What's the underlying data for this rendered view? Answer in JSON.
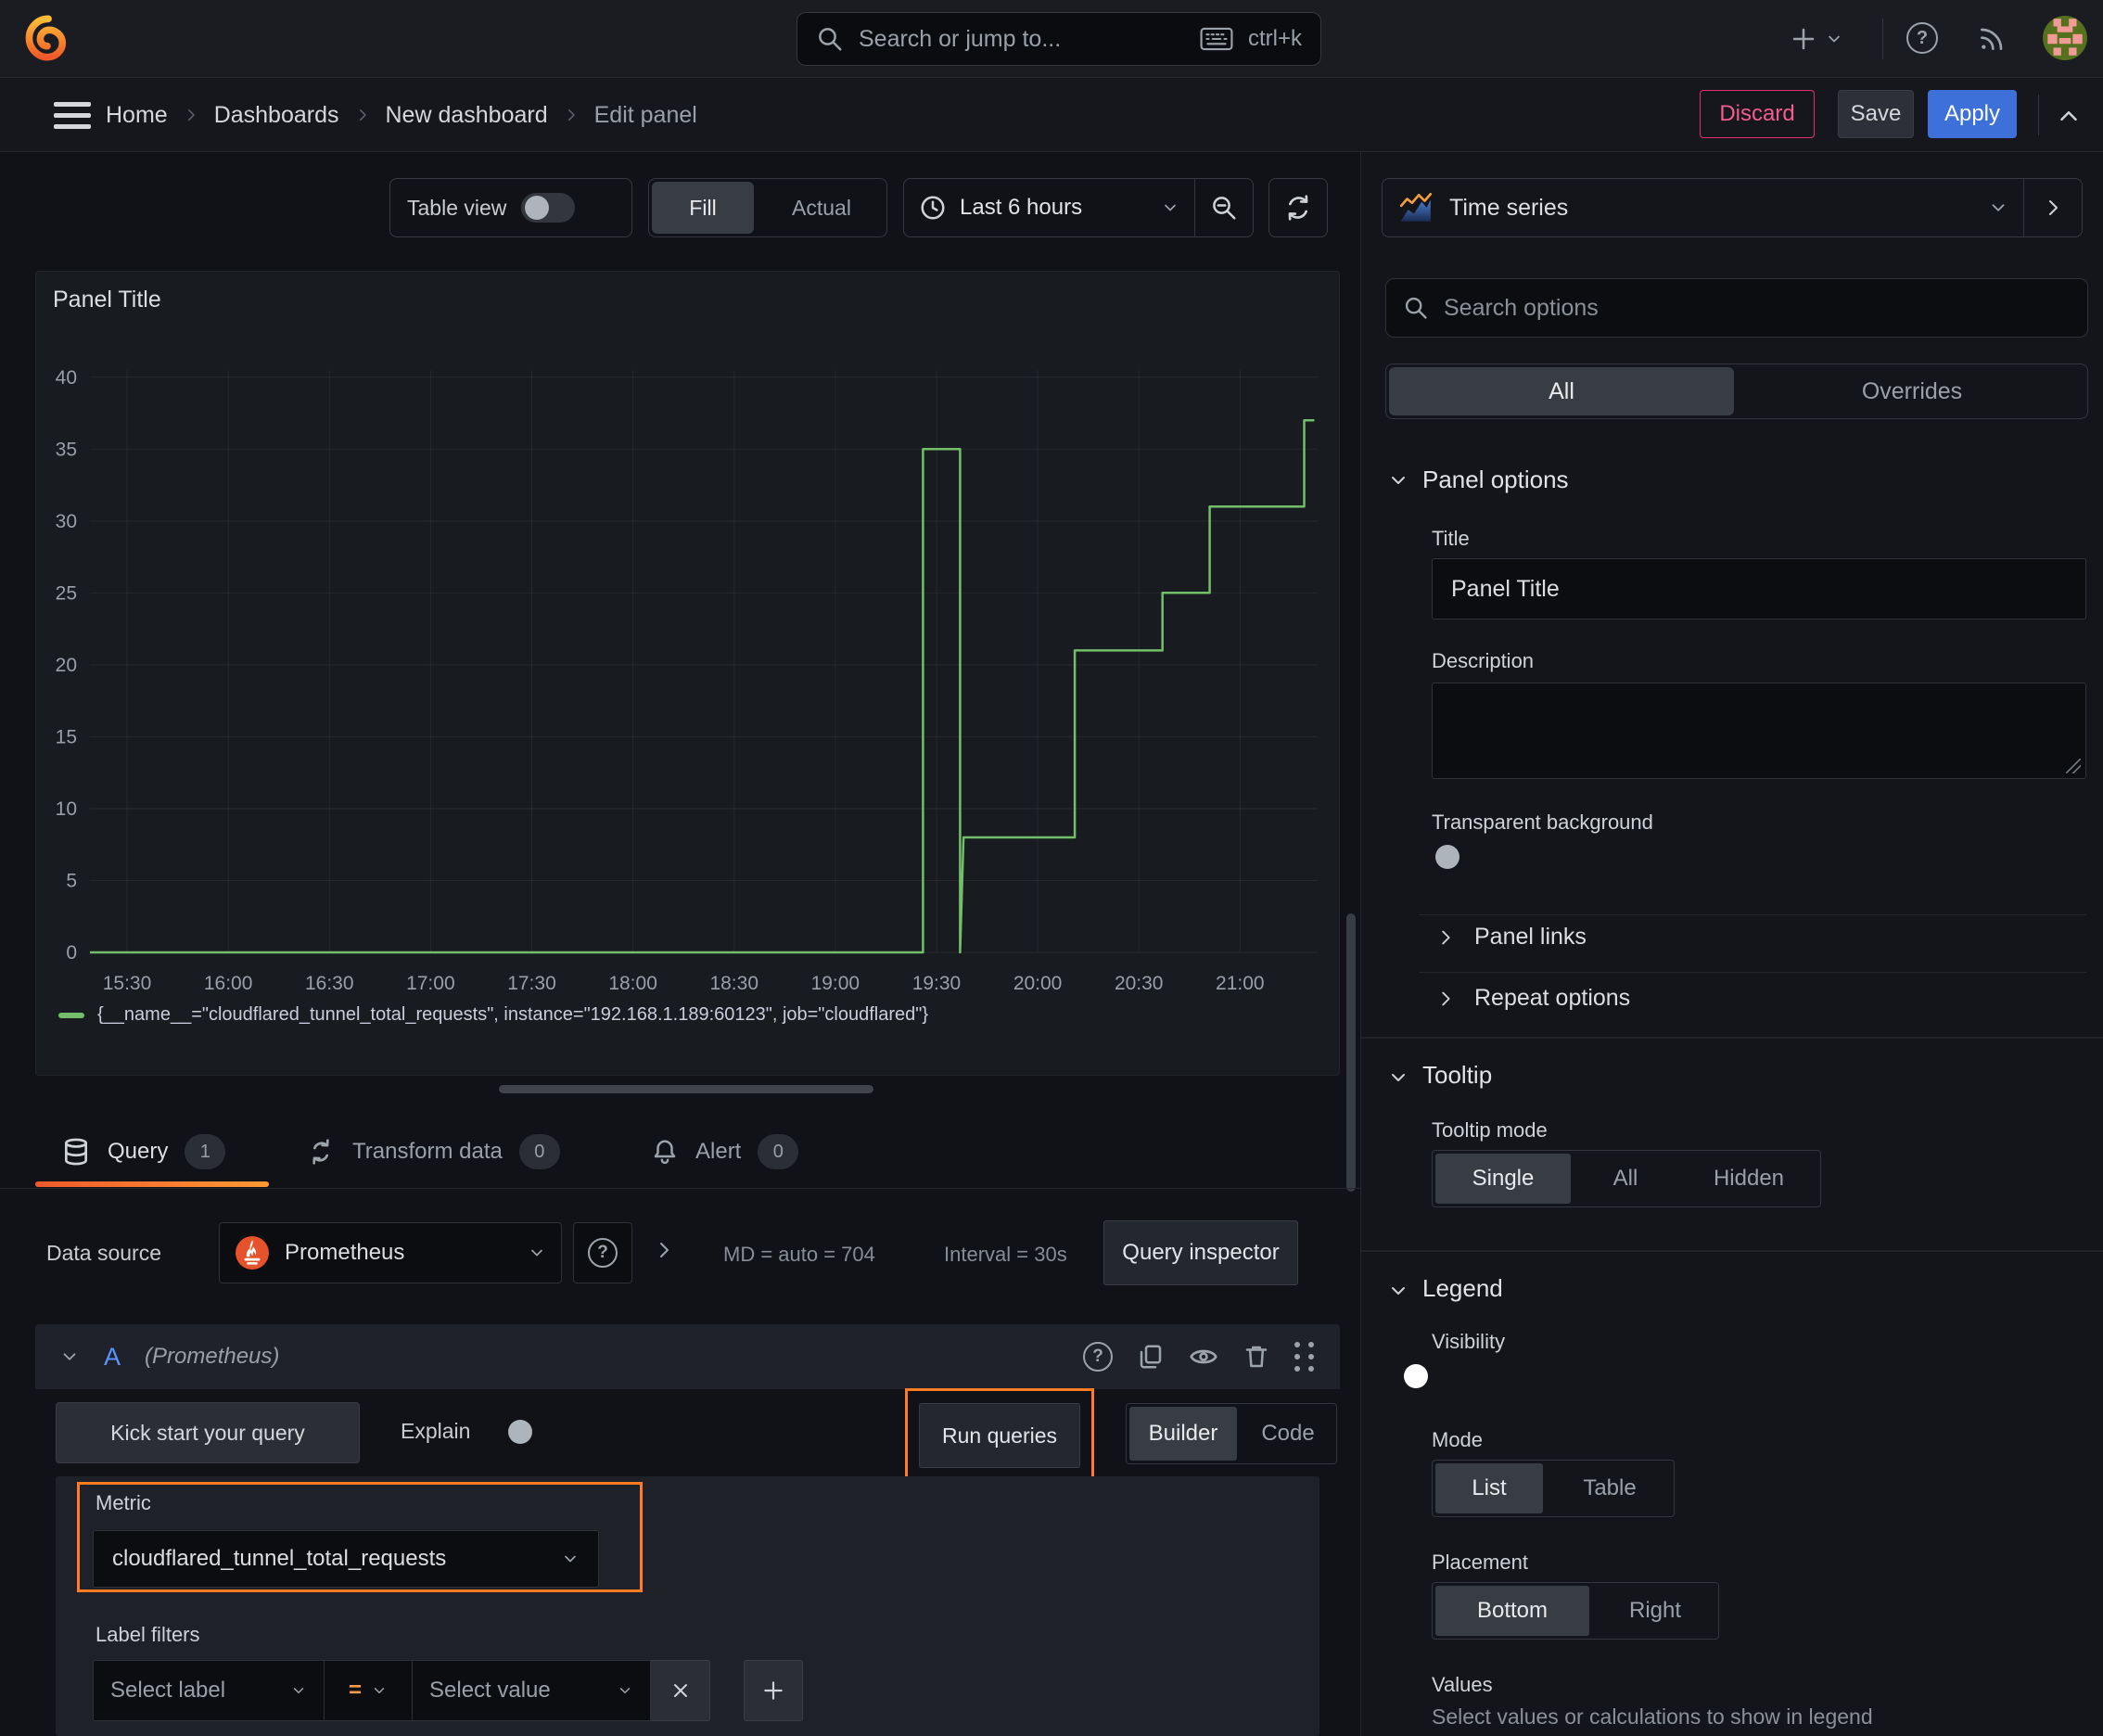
{
  "topbar": {
    "search_placeholder": "Search or jump to...",
    "search_shortcut": "ctrl+k"
  },
  "breadcrumb": {
    "items": [
      "Home",
      "Dashboards",
      "New dashboard",
      "Edit panel"
    ]
  },
  "actions": {
    "discard": "Discard",
    "save": "Save",
    "apply": "Apply"
  },
  "panel_toolbar": {
    "table_view_label": "Table view",
    "fill": "Fill",
    "actual": "Actual",
    "time_range": "Last 6 hours"
  },
  "viz_picker": {
    "label": "Time series"
  },
  "panel": {
    "title": "Panel Title"
  },
  "chart_data": {
    "type": "line",
    "title": "Panel Title",
    "x_start": "15:19",
    "x_end": "21:23",
    "x_ticks": [
      "15:30",
      "16:00",
      "16:30",
      "17:00",
      "17:30",
      "18:00",
      "18:30",
      "19:00",
      "19:30",
      "20:00",
      "20:30",
      "21:00"
    ],
    "y_ticks": [
      0,
      5,
      10,
      15,
      20,
      25,
      30,
      35,
      40
    ],
    "y_max": 40.5,
    "grid": true,
    "legend_position": "bottom",
    "series": [
      {
        "name": "{__name__=\"cloudflared_tunnel_total_requests\", instance=\"192.168.1.189:60123\", job=\"cloudflared\"}",
        "color": "#73BF69",
        "points": [
          [
            "15:19",
            0
          ],
          [
            "19:26",
            0
          ],
          [
            "19:26",
            35
          ],
          [
            "19:37",
            35
          ],
          [
            "19:37",
            0
          ],
          [
            "19:38",
            8
          ],
          [
            "20:11",
            8
          ],
          [
            "20:11",
            21
          ],
          [
            "20:37",
            21
          ],
          [
            "20:37",
            25
          ],
          [
            "20:51",
            25
          ],
          [
            "20:51",
            31
          ],
          [
            "21:19",
            31
          ],
          [
            "21:19",
            37
          ],
          [
            "21:22",
            37
          ]
        ]
      }
    ]
  },
  "tabs": {
    "query": {
      "label": "Query",
      "count": "1"
    },
    "transform": {
      "label": "Transform data",
      "count": "0"
    },
    "alert": {
      "label": "Alert",
      "count": "0"
    }
  },
  "datasource_row": {
    "label": "Data source",
    "value": "Prometheus",
    "md_info": "MD = auto = 704",
    "interval_info": "Interval = 30s",
    "inspector": "Query inspector"
  },
  "query_editor": {
    "ref_id": "A",
    "ds_hint": "(Prometheus)",
    "kick_start": "Kick start your query",
    "explain_label": "Explain",
    "run_queries": "Run queries",
    "builder": "Builder",
    "code": "Code",
    "metric_label": "Metric",
    "metric_value": "cloudflared_tunnel_total_requests",
    "label_filters_label": "Label filters",
    "select_label_placeholder": "Select label",
    "operator": "=",
    "select_value_placeholder": "Select value"
  },
  "options_pane": {
    "search_placeholder": "Search options",
    "tab_all": "All",
    "tab_overrides": "Overrides",
    "panel_options": {
      "header": "Panel options",
      "title_label": "Title",
      "title_value": "Panel Title",
      "description_label": "Description",
      "transparent_label": "Transparent background"
    },
    "panel_links_header": "Panel links",
    "repeat_options_header": "Repeat options",
    "tooltip": {
      "header": "Tooltip",
      "mode_label": "Tooltip mode",
      "options": [
        "Single",
        "All",
        "Hidden"
      ],
      "selected": "Single"
    },
    "legend": {
      "header": "Legend",
      "visibility_label": "Visibility",
      "mode_label": "Mode",
      "mode_options": [
        "List",
        "Table"
      ],
      "mode_selected": "List",
      "placement_label": "Placement",
      "placement_options": [
        "Bottom",
        "Right"
      ],
      "placement_selected": "Bottom",
      "values_label": "Values",
      "values_hint": "Select values or calculations to show in legend"
    }
  },
  "colors": {
    "accent_orange": "#FF7C24",
    "series_green": "#73BF69",
    "primary_blue": "#3D71D9",
    "danger_pink": "#F25C8E",
    "tab_underline_from": "#F0592B",
    "tab_underline_to": "#FF9933"
  }
}
